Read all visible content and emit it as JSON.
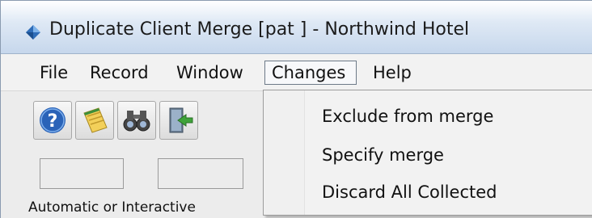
{
  "window": {
    "title": "Duplicate Client Merge [pat    ] - Northwind Hotel",
    "app_icon": "diamond-app-icon"
  },
  "menubar": {
    "items": [
      {
        "label": "File"
      },
      {
        "label": "Record"
      },
      {
        "label": "Window"
      },
      {
        "label": "Changes",
        "active": true
      },
      {
        "label": "Help"
      }
    ]
  },
  "toolbar": {
    "buttons": [
      {
        "icon": "help-icon"
      },
      {
        "icon": "notepad-icon"
      },
      {
        "icon": "binoculars-icon"
      },
      {
        "icon": "exit-door-icon"
      }
    ],
    "mode_label": "Automatic or Interactive"
  },
  "changes_menu": {
    "items": [
      {
        "label": "Exclude from merge"
      },
      {
        "label": "Specify merge"
      },
      {
        "label": "Discard All Collected"
      }
    ]
  }
}
